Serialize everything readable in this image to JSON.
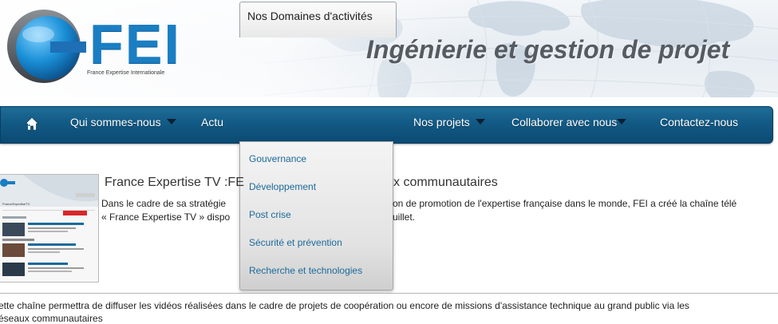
{
  "header": {
    "logo_text": "FEI",
    "logo_caption": "France Expertise Internationale",
    "tagline": "Ingénierie et gestion de projet"
  },
  "nav": {
    "home_icon": "home-icon",
    "items": [
      {
        "label": "Qui sommes-nous",
        "has_caret": true
      },
      {
        "label": "Actu",
        "has_caret": false
      },
      {
        "label": "Nos Domaines d'activités",
        "has_caret": true,
        "active": true
      },
      {
        "label": "Nos projets",
        "has_caret": true
      },
      {
        "label": "Collaborer avec nous",
        "has_caret": true
      },
      {
        "label": "Contactez-nous",
        "has_caret": false
      }
    ],
    "colors": {
      "bar": "#125a85",
      "active_bg": "#f2f2f2",
      "link": "#1b6a9b"
    }
  },
  "dropdown": {
    "items": [
      "Gouvernance",
      "Développement",
      "Post crise",
      "Sécurité et prévention",
      "Recherche et technologies"
    ]
  },
  "article": {
    "title_left": "France Expertise TV :FE",
    "title_right": "x communautaires",
    "line1_left": "Dans le cadre de sa stratégie",
    "line1_right": "on de promotion de l'expertise française dans le monde, FEI a créé la chaîne télé",
    "line2_left": "« France Expertise TV » dispo",
    "line2_right": "uillet.",
    "body_line1": "ette chaîne permettra de diffuser les vidéos réalisées dans le cadre de projets de coopération ou encore de missions d'assistance technique au grand public via les",
    "body_line2": "éseaux communautaires"
  },
  "thumbnail": {
    "channel_label": "FranceExpertiseTV"
  }
}
